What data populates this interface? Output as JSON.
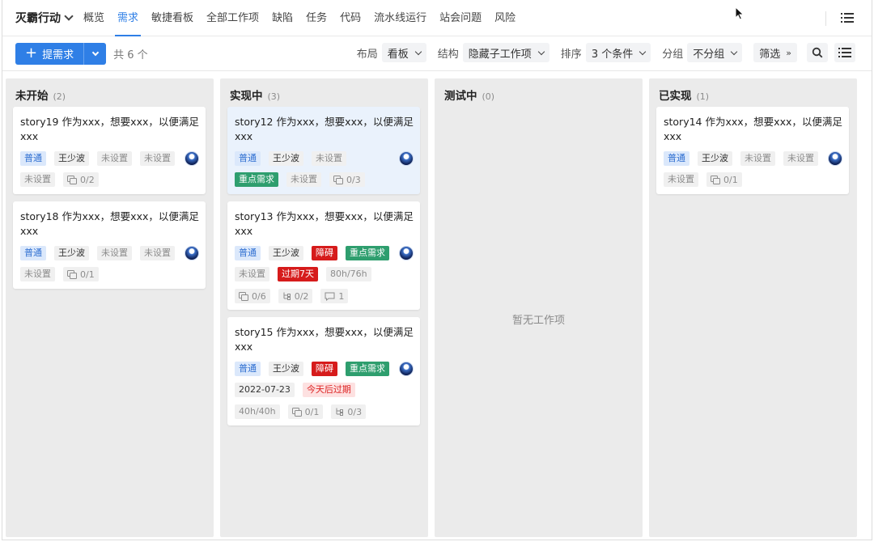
{
  "project": {
    "name": "灭霸行动"
  },
  "nav": {
    "tabs": [
      "概览",
      "需求",
      "敏捷看板",
      "全部工作项",
      "缺陷",
      "任务",
      "代码",
      "流水线运行",
      "站会问题",
      "风险"
    ],
    "active_index": 1
  },
  "toolbar": {
    "create_label": "提需求",
    "count_text": "共 6 个",
    "layout_label": "布局",
    "layout_value": "看板",
    "structure_label": "结构",
    "structure_value": "隐藏子工作项",
    "sort_label": "排序",
    "sort_value": "3 个条件",
    "group_label": "分组",
    "group_value": "不分组",
    "filter_label": "筛选"
  },
  "columns": [
    {
      "title": "未开始",
      "count": "(2)"
    },
    {
      "title": "实现中",
      "count": "(3)"
    },
    {
      "title": "测试中",
      "count": "(0)",
      "empty_text": "暂无工作项"
    },
    {
      "title": "已实现",
      "count": "(1)"
    }
  ],
  "cards": {
    "c19": {
      "title": "story19 作为xxx，想要xxx，以便满足xxx",
      "priority": "普通",
      "owner": "王少波",
      "f1": "未设置",
      "f2": "未设置",
      "f3": "未设置",
      "sub": "0/2"
    },
    "c18": {
      "title": "story18 作为xxx，想要xxx，以便满足xxx",
      "priority": "普通",
      "owner": "王少波",
      "f1": "未设置",
      "f2": "未设置",
      "f3": "未设置",
      "sub": "0/1"
    },
    "c12": {
      "title": "story12 作为xxx，想要xxx，以便满足xxx",
      "priority": "普通",
      "owner": "王少波",
      "f1": "未设置",
      "key": "重点需求",
      "f2": "未设置",
      "sub": "0/3"
    },
    "c13": {
      "title": "story13 作为xxx，想要xxx，以便满足xxx",
      "priority": "普通",
      "owner": "王少波",
      "block": "障碍",
      "key": "重点需求",
      "f1": "未设置",
      "overdue": "过期7天",
      "hours": "80h/76h",
      "sub": "0/6",
      "branch": "0/2",
      "comments": "1"
    },
    "c15": {
      "title": "story15 作为xxx，想要xxx，以便满足xxx",
      "priority": "普通",
      "owner": "王少波",
      "block": "障碍",
      "key": "重点需求",
      "date": "2022-07-23",
      "due": "今天后过期",
      "hours": "40h/40h",
      "sub": "0/1",
      "branch": "0/3"
    },
    "c14": {
      "title": "story14 作为xxx，想要xxx，以便满足xxx",
      "priority": "普通",
      "owner": "王少波",
      "f1": "未设置",
      "f2": "未设置",
      "f3": "未设置",
      "sub": "0/1"
    }
  }
}
